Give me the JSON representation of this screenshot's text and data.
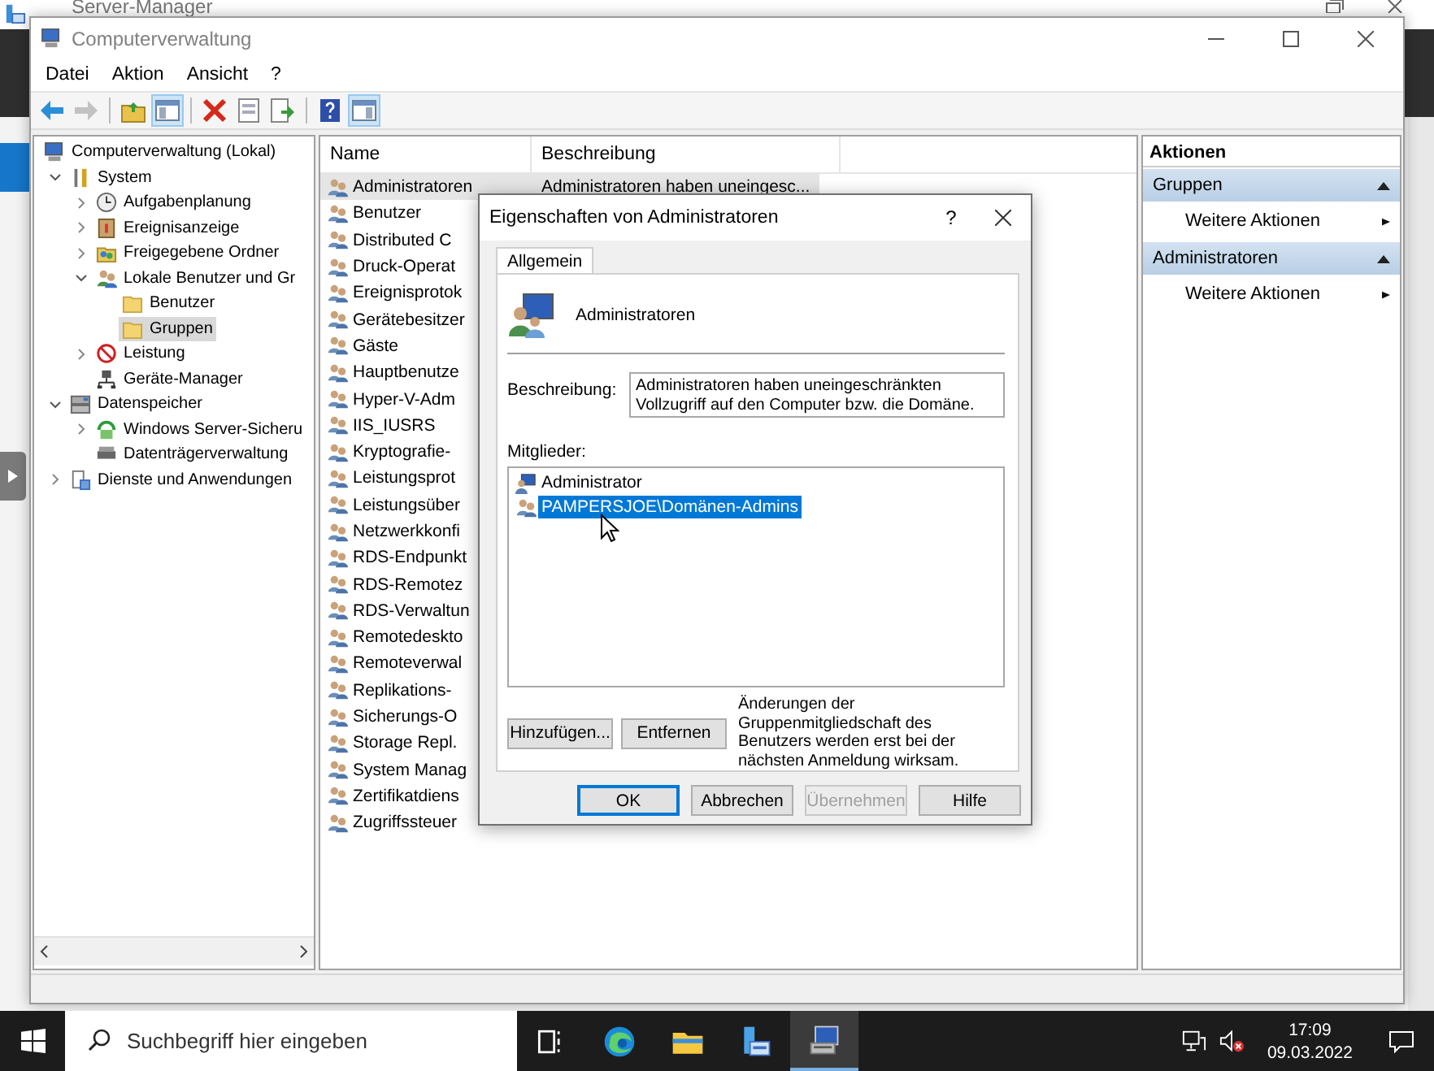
{
  "background_window": {
    "title": "Server-Manager"
  },
  "window": {
    "title": "Computerverwaltung",
    "menu": [
      "Datei",
      "Aktion",
      "Ansicht",
      "?"
    ],
    "toolbar": [
      {
        "kind": "back",
        "pressed": false,
        "disabled": false
      },
      {
        "kind": "forward",
        "pressed": false,
        "disabled": true
      },
      {
        "kind": "up",
        "pressed": false,
        "disabled": false
      },
      {
        "kind": "tree-toggle",
        "pressed": true,
        "disabled": false
      },
      {
        "kind": "delete",
        "pressed": false,
        "disabled": false
      },
      {
        "kind": "properties",
        "pressed": false,
        "disabled": false
      },
      {
        "kind": "export",
        "pressed": false,
        "disabled": false
      },
      {
        "kind": "help",
        "pressed": false,
        "disabled": false
      },
      {
        "kind": "action-toggle",
        "pressed": true,
        "disabled": false
      }
    ],
    "tree": [
      {
        "label": "Computerverwaltung (Lokal)",
        "kind": "computer",
        "selected": false,
        "children": [
          {
            "label": "System",
            "kind": "tools",
            "expanded": true,
            "selected": false,
            "children": [
              {
                "label": "Aufgabenplanung",
                "kind": "clock",
                "expanded": false,
                "selected": false
              },
              {
                "label": "Ereignisanzeige",
                "kind": "log",
                "expanded": false,
                "selected": false
              },
              {
                "label": "Freigegebene Ordner",
                "kind": "share",
                "expanded": false,
                "selected": false
              },
              {
                "label": "Lokale Benutzer und Gr",
                "kind": "users",
                "expanded": true,
                "selected": false,
                "children": [
                  {
                    "label": "Benutzer",
                    "kind": "folder",
                    "selected": false
                  },
                  {
                    "label": "Gruppen",
                    "kind": "folder",
                    "selected": true
                  }
                ]
              },
              {
                "label": "Leistung",
                "kind": "perf",
                "expanded": false,
                "selected": false
              },
              {
                "label": "Geräte-Manager",
                "kind": "device",
                "selected": false
              }
            ]
          },
          {
            "label": "Datenspeicher",
            "kind": "storage",
            "expanded": true,
            "selected": false,
            "children": [
              {
                "label": "Windows Server-Sicheru",
                "kind": "backup",
                "expanded": false,
                "selected": false
              },
              {
                "label": "Datenträgerverwaltung",
                "kind": "disk",
                "selected": false
              }
            ]
          },
          {
            "label": "Dienste und Anwendungen",
            "kind": "services",
            "expanded": false,
            "selected": false
          }
        ]
      }
    ],
    "list": {
      "columns": [
        "Name",
        "Beschreibung"
      ],
      "rows": [
        {
          "name": "Administratoren",
          "description": "Administratoren haben uneingesc...",
          "selected": true
        },
        {
          "name": "Benutzer",
          "selected": false
        },
        {
          "name": "Distributed C",
          "selected": false
        },
        {
          "name": "Druck-Operat",
          "selected": false
        },
        {
          "name": "Ereignisprotok",
          "selected": false
        },
        {
          "name": "Gerätebesitzer",
          "selected": false
        },
        {
          "name": "Gäste",
          "selected": false
        },
        {
          "name": "Hauptbenutze",
          "selected": false
        },
        {
          "name": "Hyper-V-Adm",
          "selected": false
        },
        {
          "name": "IIS_IUSRS",
          "selected": false
        },
        {
          "name": "Kryptografie-",
          "selected": false
        },
        {
          "name": "Leistungsprot",
          "selected": false
        },
        {
          "name": "Leistungsüber",
          "selected": false
        },
        {
          "name": "Netzwerkkonfi",
          "selected": false
        },
        {
          "name": "RDS-Endpunkt",
          "selected": false
        },
        {
          "name": "RDS-Remotez",
          "selected": false
        },
        {
          "name": "RDS-Verwaltun",
          "selected": false
        },
        {
          "name": "Remotedeskto",
          "selected": false
        },
        {
          "name": "Remoteverwal",
          "selected": false
        },
        {
          "name": "Replikations-",
          "selected": false
        },
        {
          "name": "Sicherungs-O",
          "selected": false
        },
        {
          "name": "Storage Repl.",
          "selected": false
        },
        {
          "name": "System Manag",
          "selected": false
        },
        {
          "name": "Zertifikatdiens",
          "selected": false
        },
        {
          "name": "Zugriffssteuer",
          "selected": false
        }
      ]
    },
    "actions": {
      "title": "Aktionen",
      "sections": [
        {
          "title": "Gruppen",
          "expanded": true,
          "items": [
            "Weitere Aktionen"
          ]
        },
        {
          "title": "Administratoren",
          "expanded": true,
          "items": [
            "Weitere Aktionen"
          ]
        }
      ]
    }
  },
  "dialog": {
    "title": "Eigenschaften von Administratoren",
    "help": "?",
    "tabs": [
      {
        "label": "Allgemein",
        "selected": true
      }
    ],
    "group_name": "Administratoren",
    "description_label": "Beschreibung:",
    "description": "Administratoren haben uneingeschränkten Vollzugriff auf den Computer bzw. die Domäne.",
    "members_label": "Mitglieder:",
    "members": [
      {
        "name": "Administrator",
        "kind": "user",
        "selected": false
      },
      {
        "name": "PAMPERSJOE\\Domänen-Admins",
        "kind": "group",
        "selected": true
      }
    ],
    "member_buttons": [
      "Hinzufügen...",
      "Entfernen"
    ],
    "note": "Änderungen der Gruppenmitgliedschaft des Benutzers werden erst bei der nächsten Anmeldung wirksam.",
    "buttons": [
      {
        "label": "OK",
        "default": true,
        "disabled": false
      },
      {
        "label": "Abbrechen",
        "default": false,
        "disabled": false
      },
      {
        "label": "Übernehmen",
        "default": false,
        "disabled": true
      },
      {
        "label": "Hilfe",
        "default": false,
        "disabled": false
      }
    ]
  },
  "taskbar": {
    "search": {
      "placeholder": "Suchbegriff hier eingeben"
    },
    "apps": [
      {
        "kind": "task-view",
        "active": false
      },
      {
        "kind": "edge",
        "active": false
      },
      {
        "kind": "explorer",
        "active": false
      },
      {
        "kind": "server-manager",
        "active": false
      },
      {
        "kind": "computer-management",
        "active": true
      }
    ],
    "time": "17:09",
    "date": "09.03.2022"
  }
}
